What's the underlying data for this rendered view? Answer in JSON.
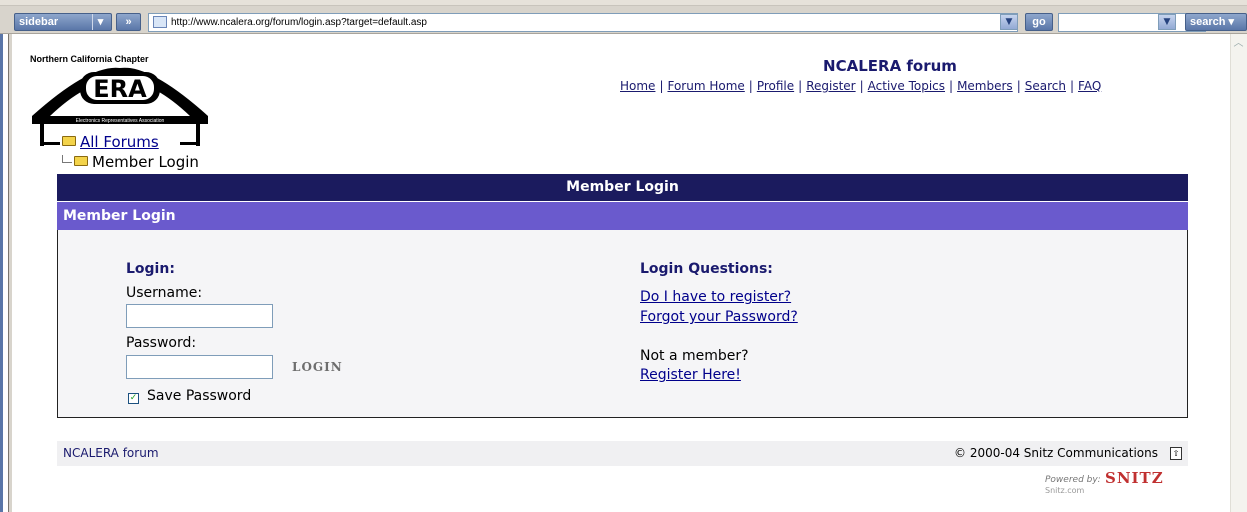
{
  "browser": {
    "sidebar_label": "sidebar",
    "url": "http://www.ncalera.org/forum/login.asp?target=default.asp",
    "go_label": "go",
    "search_label": "search"
  },
  "logo": {
    "caption": "Northern California Chapter",
    "org_name": "Electronics Representatives Association"
  },
  "forum_title": "NCALERA forum",
  "nav": {
    "items": [
      "Home",
      "Forum Home",
      "Profile",
      "Register",
      "Active Topics",
      "Members",
      "Search",
      "FAQ"
    ],
    "separator": "|"
  },
  "breadcrumb": {
    "all_forums": "All Forums",
    "current": "Member Login"
  },
  "panel": {
    "header": "Member Login",
    "subheader": "Member Login"
  },
  "login": {
    "heading": "Login:",
    "username_label": "Username:",
    "username_value": "",
    "password_label": "Password:",
    "password_value": "",
    "login_button": "LOGIN",
    "save_password_label": "Save Password",
    "save_password_checked": true
  },
  "questions": {
    "heading": "Login Questions:",
    "link1": "Do I have to register?",
    "link2": "Forgot your Password?",
    "not_member": "Not a member?",
    "register_link": "Register Here!"
  },
  "footer": {
    "left": "NCALERA forum",
    "right": "© 2000-04 Snitz Communications",
    "powered_by": "Powered by:",
    "snitz": "SNITZ",
    "snitz_sub": "Snitz.com"
  },
  "colors": {
    "header_bar": "#1b1b5e",
    "sub_bar": "#6a5acd",
    "link": "#00008b",
    "title": "#1a1a6e"
  }
}
